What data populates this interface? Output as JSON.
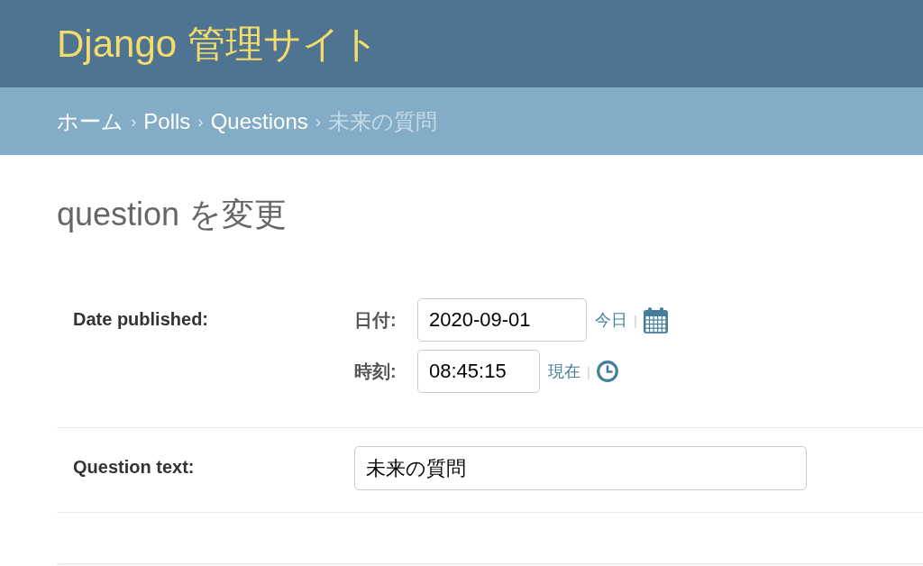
{
  "header": {
    "title": "Django 管理サイト"
  },
  "breadcrumbs": [
    {
      "label": "ホーム",
      "current": false
    },
    {
      "separator": "›",
      "label": "Polls",
      "current": false
    },
    {
      "separator": "›",
      "label": "Questions",
      "current": false
    },
    {
      "separator": "›",
      "label": "未来の質問",
      "current": true
    }
  ],
  "page_title": "question を変更",
  "form": {
    "rows": [
      {
        "kind": "datetime",
        "label": "Date published:",
        "parts": [
          {
            "kind": "date",
            "label": "日付:",
            "value": "2020-09-01",
            "shortcut": "今日",
            "divider": "|"
          },
          {
            "kind": "time",
            "label": "時刻:",
            "value": "08:45:15",
            "shortcut": "現在",
            "divider": "|"
          }
        ]
      },
      {
        "kind": "text",
        "label": "Question text:",
        "value": "未来の質問"
      }
    ]
  }
}
